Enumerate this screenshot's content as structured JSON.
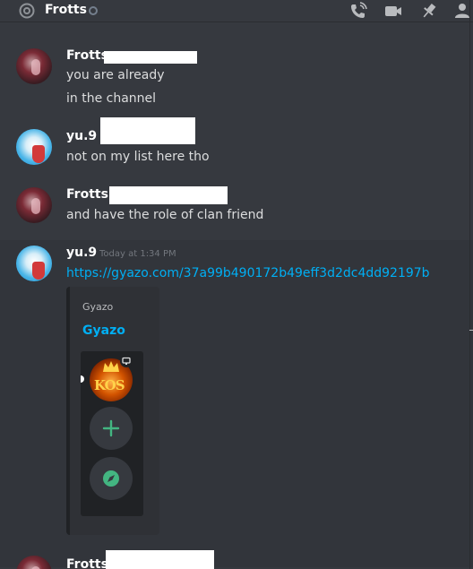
{
  "header": {
    "channel_name": "Frotts",
    "icons": [
      "at-icon",
      "status-dot",
      "phone-call-icon",
      "video-camera-icon",
      "pin-icon"
    ]
  },
  "messages": [
    {
      "author": "Frotts",
      "avatar": "frotts-avatar",
      "lines": [
        "you are already",
        "in the channel"
      ]
    },
    {
      "author": "yu.9",
      "avatar": "yu9-avatar",
      "lines": [
        "not on my list here tho"
      ]
    },
    {
      "author": "Frotts",
      "avatar": "frotts-avatar",
      "lines": [
        "and have the role of clan friend"
      ]
    },
    {
      "author": "yu.9",
      "avatar": "yu9-avatar",
      "timestamp": "Today at 1:34 PM",
      "link": "https://gyazo.com/37a99b490172b49eff3d2dc4dd92197b",
      "embed": {
        "provider": "Gyazo",
        "title": "Gyazo",
        "image": {
          "server_icon_text": "KOS",
          "icons": [
            "monitor-icon",
            "plus-icon",
            "compass-icon"
          ]
        }
      }
    },
    {
      "author": "Frotts",
      "avatar": "frotts-avatar"
    }
  ],
  "colors": {
    "background": "#36393f",
    "hover_background": "#32353b",
    "link": "#00aff4",
    "username": "#ffffff",
    "text": "#dcddde",
    "green_icon": "#43b581"
  }
}
